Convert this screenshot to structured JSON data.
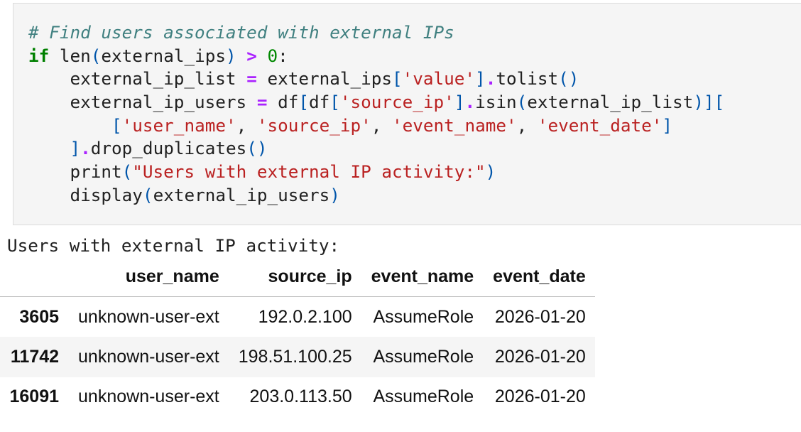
{
  "code_cell": {
    "lines": [
      [
        {
          "t": "cm",
          "v": "# Find users associated with external IPs"
        }
      ],
      [
        {
          "t": "kw",
          "v": "if"
        },
        {
          "t": "nb",
          "v": " len"
        },
        {
          "t": "p",
          "v": "("
        },
        {
          "t": "nb",
          "v": "external_ips"
        },
        {
          "t": "p",
          "v": ")"
        },
        {
          "t": "nb",
          "v": " "
        },
        {
          "t": "op",
          "v": ">"
        },
        {
          "t": "nb",
          "v": " "
        },
        {
          "t": "num",
          "v": "0"
        },
        {
          "t": "nb",
          "v": ":"
        }
      ],
      [
        {
          "t": "nb",
          "v": "    external_ip_list "
        },
        {
          "t": "op",
          "v": "="
        },
        {
          "t": "nb",
          "v": " external_ips"
        },
        {
          "t": "p",
          "v": "["
        },
        {
          "t": "str",
          "v": "'value'"
        },
        {
          "t": "p",
          "v": "]"
        },
        {
          "t": "op",
          "v": "."
        },
        {
          "t": "nb",
          "v": "tolist"
        },
        {
          "t": "p",
          "v": "()"
        }
      ],
      [
        {
          "t": "nb",
          "v": "    external_ip_users "
        },
        {
          "t": "op",
          "v": "="
        },
        {
          "t": "nb",
          "v": " df"
        },
        {
          "t": "p",
          "v": "["
        },
        {
          "t": "nb",
          "v": "df"
        },
        {
          "t": "p",
          "v": "["
        },
        {
          "t": "str",
          "v": "'source_ip'"
        },
        {
          "t": "p",
          "v": "]"
        },
        {
          "t": "op",
          "v": "."
        },
        {
          "t": "nb",
          "v": "isin"
        },
        {
          "t": "p",
          "v": "("
        },
        {
          "t": "nb",
          "v": "external_ip_list"
        },
        {
          "t": "p",
          "v": ")"
        },
        {
          "t": "p",
          "v": "]["
        }
      ],
      [
        {
          "t": "nb",
          "v": "        "
        },
        {
          "t": "p",
          "v": "["
        },
        {
          "t": "str",
          "v": "'user_name'"
        },
        {
          "t": "nb",
          "v": ", "
        },
        {
          "t": "str",
          "v": "'source_ip'"
        },
        {
          "t": "nb",
          "v": ", "
        },
        {
          "t": "str",
          "v": "'event_name'"
        },
        {
          "t": "nb",
          "v": ", "
        },
        {
          "t": "str",
          "v": "'event_date'"
        },
        {
          "t": "p",
          "v": "]"
        }
      ],
      [
        {
          "t": "nb",
          "v": "    "
        },
        {
          "t": "p",
          "v": "]"
        },
        {
          "t": "op",
          "v": "."
        },
        {
          "t": "nb",
          "v": "drop_duplicates"
        },
        {
          "t": "p",
          "v": "()"
        }
      ],
      [
        {
          "t": "nb",
          "v": "    print"
        },
        {
          "t": "p",
          "v": "("
        },
        {
          "t": "str",
          "v": "\"Users with external IP activity:\""
        },
        {
          "t": "p",
          "v": ")"
        }
      ],
      [
        {
          "t": "nb",
          "v": "    display"
        },
        {
          "t": "p",
          "v": "("
        },
        {
          "t": "nb",
          "v": "external_ip_users"
        },
        {
          "t": "p",
          "v": ")"
        }
      ]
    ]
  },
  "output": {
    "stdout": "Users with external IP activity:",
    "table": {
      "columns": [
        "user_name",
        "source_ip",
        "event_name",
        "event_date"
      ],
      "rows": [
        {
          "index": "3605",
          "user_name": "unknown-user-ext",
          "source_ip": "192.0.2.100",
          "event_name": "AssumeRole",
          "event_date": "2026-01-20"
        },
        {
          "index": "11742",
          "user_name": "unknown-user-ext",
          "source_ip": "198.51.100.25",
          "event_name": "AssumeRole",
          "event_date": "2026-01-20"
        },
        {
          "index": "16091",
          "user_name": "unknown-user-ext",
          "source_ip": "203.0.113.50",
          "event_name": "AssumeRole",
          "event_date": "2026-01-20"
        }
      ]
    }
  }
}
